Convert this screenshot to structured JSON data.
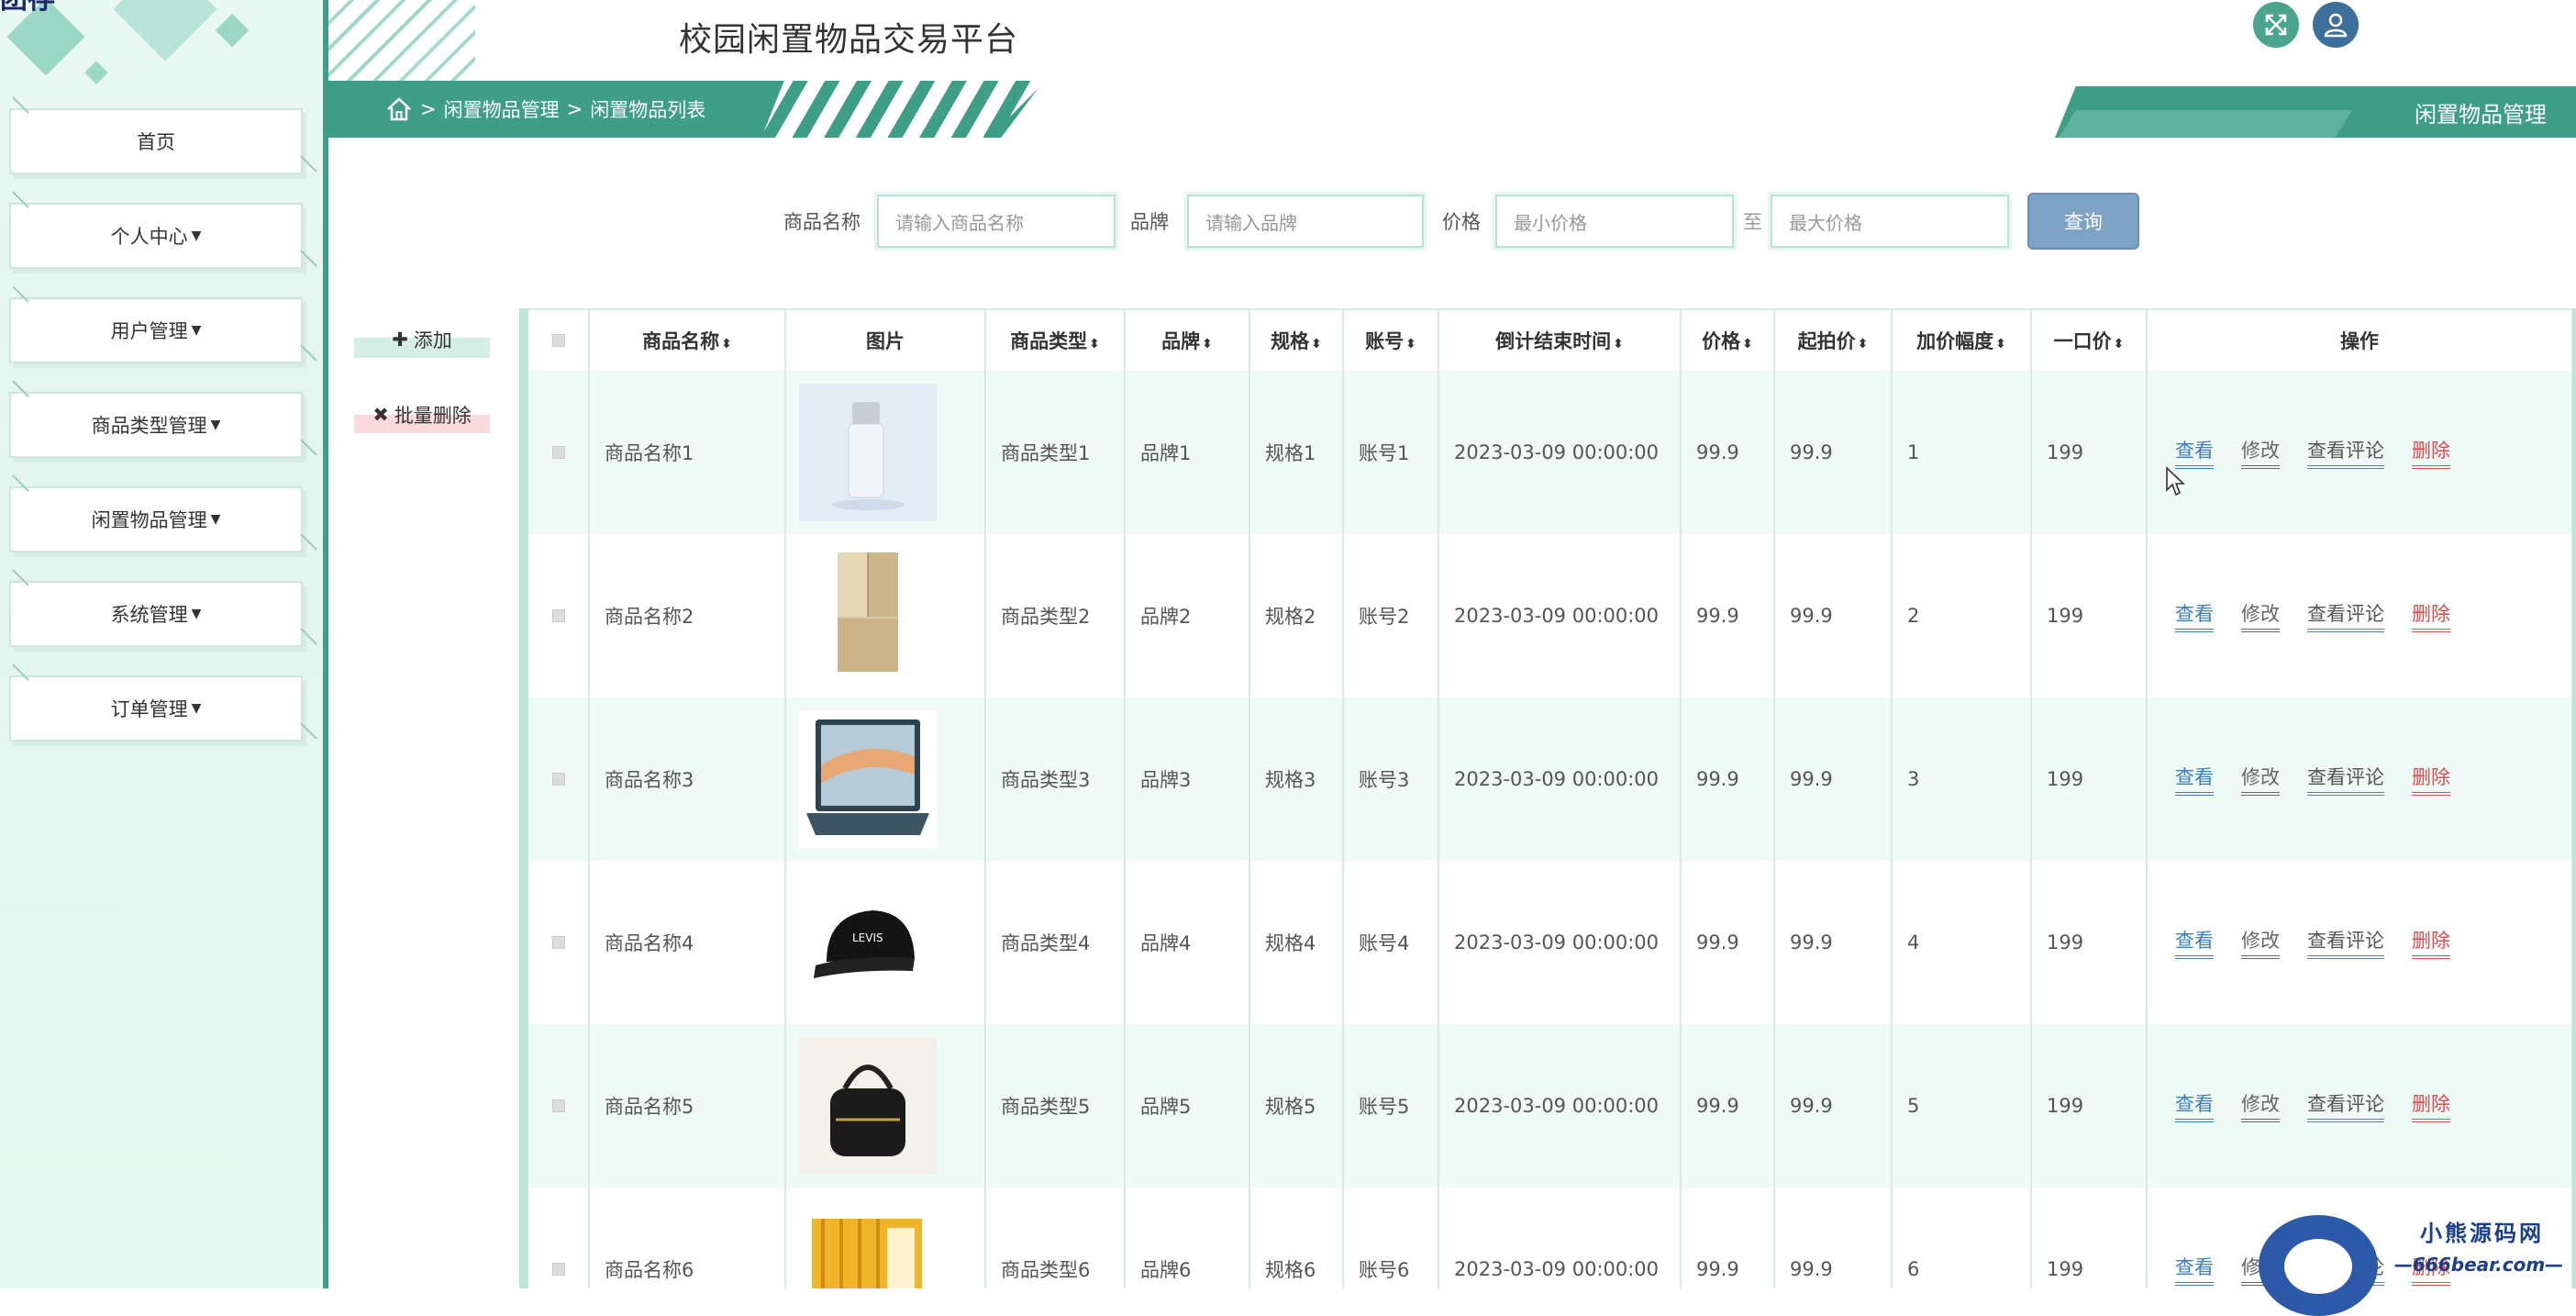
{
  "app": {
    "title": "校园闲置物品交易平台",
    "brand_fragment": "团存"
  },
  "colors": {
    "accent": "#3e9f86",
    "sidebar_bg": "#e6f6f0",
    "search_button": "#7fa3c4",
    "delete": "#e24b4b",
    "link": "#3b7ec0"
  },
  "header": {
    "fullscreen_icon": "expand-icon",
    "user_icon": "user-icon",
    "breadcrumb": {
      "home_icon": "home-icon",
      "sep": ">",
      "items": [
        "闲置物品管理",
        "闲置物品列表"
      ]
    },
    "section_tab": "闲置物品管理"
  },
  "sidebar": {
    "items": [
      {
        "label": "首页",
        "has_caret": false
      },
      {
        "label": "个人中心",
        "has_caret": true
      },
      {
        "label": "用户管理",
        "has_caret": true
      },
      {
        "label": "商品类型管理",
        "has_caret": true
      },
      {
        "label": "闲置物品管理",
        "has_caret": true
      },
      {
        "label": "系统管理",
        "has_caret": true
      },
      {
        "label": "订单管理",
        "has_caret": true
      }
    ]
  },
  "search": {
    "name_label": "商品名称",
    "name_placeholder": "请输入商品名称",
    "brand_label": "品牌",
    "brand_placeholder": "请输入品牌",
    "price_label": "价格",
    "min_placeholder": "最小价格",
    "to_label": "至",
    "max_placeholder": "最大价格",
    "button": "查询"
  },
  "actions": {
    "add": "添加",
    "batch_delete": "批量删除"
  },
  "table": {
    "columns": [
      "商品名称",
      "图片",
      "商品类型",
      "品牌",
      "规格",
      "账号",
      "倒计结束时间",
      "价格",
      "起拍价",
      "加价幅度",
      "一口价",
      "操作"
    ],
    "sort_glyph": "⬍",
    "op_labels": {
      "view": "查看",
      "edit": "修改",
      "comment": "查看评论",
      "delete": "删除"
    },
    "rows": [
      {
        "name": "商品名称1",
        "image": "serum-bottle",
        "type": "商品类型1",
        "brand": "品牌1",
        "spec": "规格1",
        "account": "账号1",
        "end": "2023-03-09 00:00:00",
        "price": "99.9",
        "start_price": "99.9",
        "increment": "1",
        "buyout": "199"
      },
      {
        "name": "商品名称2",
        "image": "refrigerator",
        "type": "商品类型2",
        "brand": "品牌2",
        "spec": "规格2",
        "account": "账号2",
        "end": "2023-03-09 00:00:00",
        "price": "99.9",
        "start_price": "99.9",
        "increment": "2",
        "buyout": "199"
      },
      {
        "name": "商品名称3",
        "image": "laptop",
        "type": "商品类型3",
        "brand": "品牌3",
        "spec": "规格3",
        "account": "账号3",
        "end": "2023-03-09 00:00:00",
        "price": "99.9",
        "start_price": "99.9",
        "increment": "3",
        "buyout": "199"
      },
      {
        "name": "商品名称4",
        "image": "baseball-cap",
        "type": "商品类型4",
        "brand": "品牌4",
        "spec": "规格4",
        "account": "账号4",
        "end": "2023-03-09 00:00:00",
        "price": "99.9",
        "start_price": "99.9",
        "increment": "4",
        "buyout": "199"
      },
      {
        "name": "商品名称5",
        "image": "handbag",
        "type": "商品类型5",
        "brand": "品牌5",
        "spec": "规格5",
        "account": "账号5",
        "end": "2023-03-09 00:00:00",
        "price": "99.9",
        "start_price": "99.9",
        "increment": "5",
        "buyout": "199"
      },
      {
        "name": "商品名称6",
        "image": "book-set",
        "type": "商品类型6",
        "brand": "品牌6",
        "spec": "规格6",
        "account": "账号6",
        "end": "2023-03-09 00:00:00",
        "price": "99.9",
        "start_price": "99.9",
        "increment": "6",
        "buyout": "199"
      }
    ]
  },
  "watermark": {
    "line1": "小熊源码网",
    "line2": "—666bear.com—"
  }
}
